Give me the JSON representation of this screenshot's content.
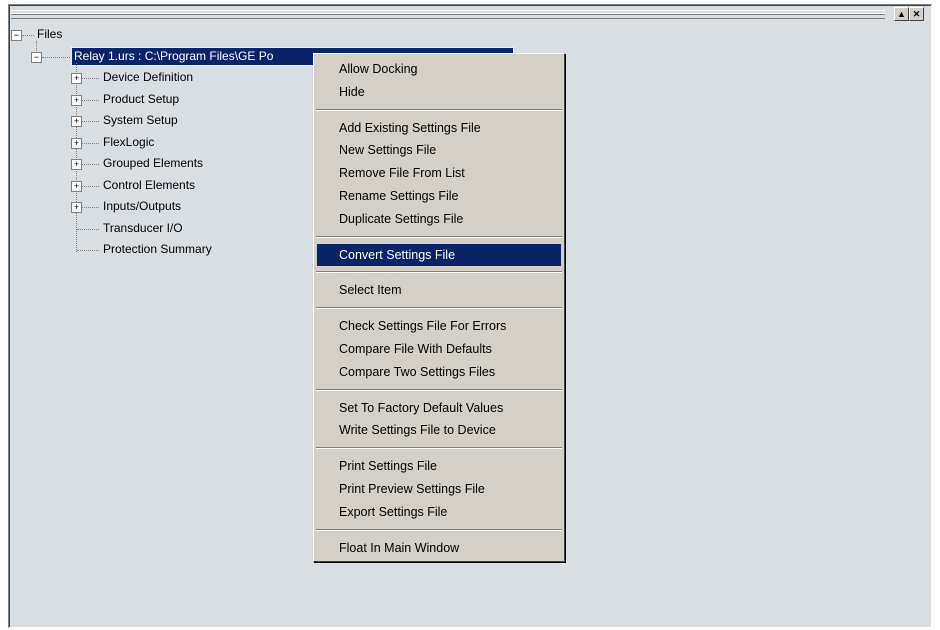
{
  "window": {
    "maximize_glyph": "▲",
    "close_glyph": "✕"
  },
  "tree": {
    "root_label": "Files",
    "root_expander": "−",
    "file_label": "Relay 1.urs : C:\\Program Files\\GE Po",
    "file_expander": "−",
    "children": [
      {
        "label": "Device Definition",
        "expander": "+"
      },
      {
        "label": "Product Setup",
        "expander": "+"
      },
      {
        "label": "System Setup",
        "expander": "+"
      },
      {
        "label": "FlexLogic",
        "expander": "+"
      },
      {
        "label": "Grouped Elements",
        "expander": "+"
      },
      {
        "label": "Control Elements",
        "expander": "+"
      },
      {
        "label": "Inputs/Outputs",
        "expander": "+"
      },
      {
        "label": "Transducer I/O",
        "expander": ""
      },
      {
        "label": "Protection Summary",
        "expander": ""
      }
    ]
  },
  "context_menu": {
    "highlighted": "Convert Settings File",
    "groups": [
      [
        "Allow Docking",
        "Hide"
      ],
      [
        "Add Existing Settings File",
        "New Settings File",
        "Remove File From List",
        "Rename Settings File",
        "Duplicate Settings File"
      ],
      [
        "Convert Settings File"
      ],
      [
        "Select Item"
      ],
      [
        "Check Settings File For Errors",
        "Compare File With Defaults",
        "Compare Two Settings Files"
      ],
      [
        "Set To Factory Default Values",
        "Write Settings File to Device"
      ],
      [
        "Print Settings File",
        "Print Preview Settings File",
        "Export Settings File"
      ],
      [
        "Float In Main Window"
      ]
    ]
  },
  "colors": {
    "panel_bg": "#d9dee3",
    "menu_bg": "#d4d0c8",
    "highlight": "#0a246a"
  }
}
